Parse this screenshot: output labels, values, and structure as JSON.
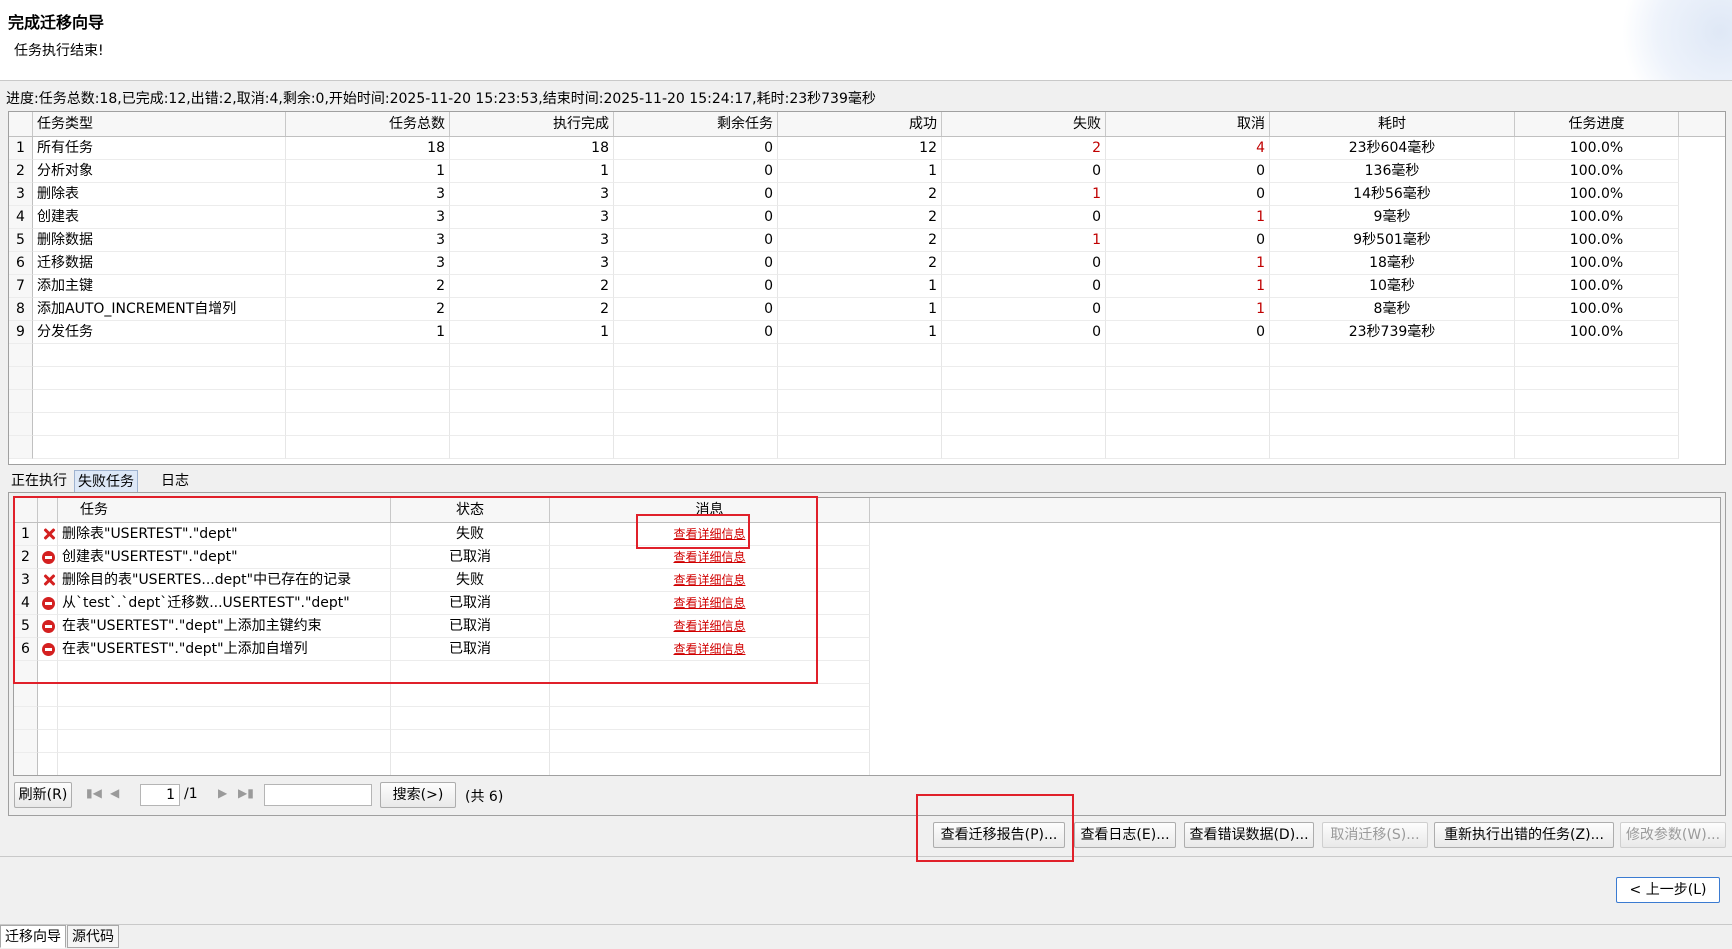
{
  "wizard": {
    "title": "完成迁移向导",
    "subtitle": "任务执行结束!"
  },
  "progress": {
    "text": "进度:任务总数:18,已完成:12,出错:2,取消:4,剩余:0,开始时间:2025-11-20 15:23:53,结束时间:2025-11-20 15:24:17,耗时:23秒739毫秒"
  },
  "summary_table": {
    "headers": [
      "任务类型",
      "任务总数",
      "执行完成",
      "剩余任务",
      "成功",
      "失败",
      "取消",
      "耗时",
      "任务进度"
    ],
    "rows": [
      {
        "num": "1",
        "type": "所有任务",
        "total": "18",
        "done": "18",
        "remaining": "0",
        "success": "12",
        "failed": "2",
        "cancelled": "4",
        "elapsed": "23秒604毫秒",
        "progress": "100.0%"
      },
      {
        "num": "2",
        "type": "分析对象",
        "total": "1",
        "done": "1",
        "remaining": "0",
        "success": "1",
        "failed": "0",
        "cancelled": "0",
        "elapsed": "136毫秒",
        "progress": "100.0%"
      },
      {
        "num": "3",
        "type": "删除表",
        "total": "3",
        "done": "3",
        "remaining": "0",
        "success": "2",
        "failed": "1",
        "cancelled": "0",
        "elapsed": "14秒56毫秒",
        "progress": "100.0%"
      },
      {
        "num": "4",
        "type": "创建表",
        "total": "3",
        "done": "3",
        "remaining": "0",
        "success": "2",
        "failed": "0",
        "cancelled": "1",
        "elapsed": "9毫秒",
        "progress": "100.0%"
      },
      {
        "num": "5",
        "type": "删除数据",
        "total": "3",
        "done": "3",
        "remaining": "0",
        "success": "2",
        "failed": "1",
        "cancelled": "0",
        "elapsed": "9秒501毫秒",
        "progress": "100.0%"
      },
      {
        "num": "6",
        "type": "迁移数据",
        "total": "3",
        "done": "3",
        "remaining": "0",
        "success": "2",
        "failed": "0",
        "cancelled": "1",
        "elapsed": "18毫秒",
        "progress": "100.0%"
      },
      {
        "num": "7",
        "type": "添加主键",
        "total": "2",
        "done": "2",
        "remaining": "0",
        "success": "1",
        "failed": "0",
        "cancelled": "1",
        "elapsed": "10毫秒",
        "progress": "100.0%"
      },
      {
        "num": "8",
        "type": "添加AUTO_INCREMENT自增列",
        "total": "2",
        "done": "2",
        "remaining": "0",
        "success": "1",
        "failed": "0",
        "cancelled": "1",
        "elapsed": "8毫秒",
        "progress": "100.0%"
      },
      {
        "num": "9",
        "type": "分发任务",
        "total": "1",
        "done": "1",
        "remaining": "0",
        "success": "1",
        "failed": "0",
        "cancelled": "0",
        "elapsed": "23秒739毫秒",
        "progress": "100.0%"
      }
    ]
  },
  "tabs": [
    "正在执行",
    "失败任务",
    "日志"
  ],
  "failed_table": {
    "headers": [
      "任务",
      "状态",
      "消息"
    ],
    "rows": [
      {
        "num": "1",
        "icon": "error-x-icon",
        "task": "删除表\"USERTEST\".\"dept\"",
        "status": "失败",
        "message": "查看详细信息"
      },
      {
        "num": "2",
        "icon": "cancel-icon",
        "task": "创建表\"USERTEST\".\"dept\"",
        "status": "已取消",
        "message": "查看详细信息"
      },
      {
        "num": "3",
        "icon": "error-x-icon",
        "task": "删除目的表\"USERTES...dept\"中已存在的记录",
        "status": "失败",
        "message": "查看详细信息"
      },
      {
        "num": "4",
        "icon": "cancel-icon",
        "task": "从`test`.`dept`迁移数...USERTEST\".\"dept\"",
        "status": "已取消",
        "message": "查看详细信息"
      },
      {
        "num": "5",
        "icon": "cancel-icon",
        "task": "在表\"USERTEST\".\"dept\"上添加主键约束",
        "status": "已取消",
        "message": "查看详细信息"
      },
      {
        "num": "6",
        "icon": "cancel-icon",
        "task": "在表\"USERTEST\".\"dept\"上添加自增列",
        "status": "已取消",
        "message": "查看详细信息"
      }
    ]
  },
  "pager": {
    "refresh": "刷新(R)",
    "page": "1",
    "total_pages": "/1",
    "search_value": "",
    "search_button": "搜索(>)",
    "count": "(共 6)"
  },
  "actions": {
    "view_report": "查看迁移报告(P)...",
    "view_log": "查看日志(E)...",
    "view_error_data": "查看错误数据(D)...",
    "cancel_migration": "取消迁移(S)...",
    "rerun_failed": "重新执行出错的任务(Z)...",
    "modify_params": "修改参数(W)..."
  },
  "navigation": {
    "back": "< 上一步(L)"
  },
  "bottom_tabs": [
    "迁移向导",
    "源代码"
  ],
  "colors": {
    "error_text": "#c00000",
    "link": "#d00000",
    "annotation": "#e0202a",
    "active_tab": "#dde8f7"
  }
}
